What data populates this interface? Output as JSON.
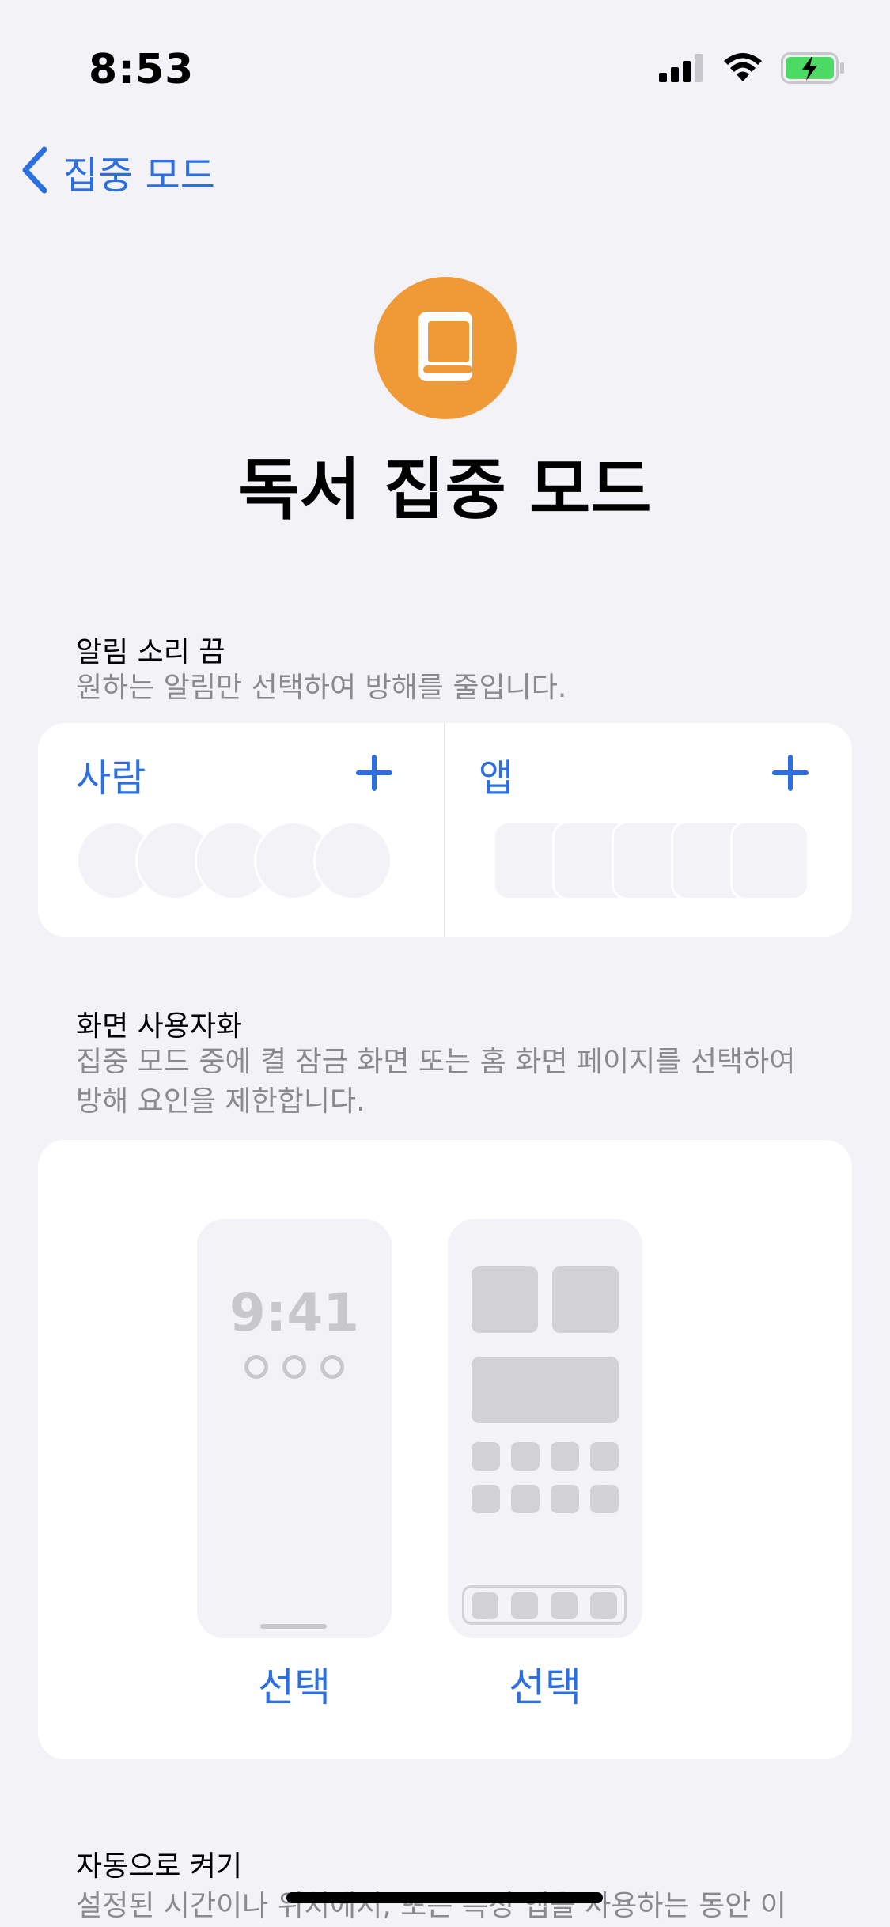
{
  "status_bar": {
    "time": "8:53",
    "signal_icon": "cellular-signal-icon",
    "wifi_icon": "wifi-icon",
    "battery_icon": "battery-charging-icon",
    "battery_color": "#4cd964"
  },
  "nav": {
    "back_label": "집중 모드",
    "back_icon": "chevron-left-icon"
  },
  "header": {
    "icon": "book-icon",
    "icon_color": "#f09a37",
    "title": "독서 집중 모드"
  },
  "notifications": {
    "title": "알림 소리 끔",
    "description": "원하는 알림만 선택하여 방해를 줄입니다.",
    "people_label": "사람",
    "apps_label": "앱",
    "add_symbol": "+"
  },
  "screens": {
    "title": "화면 사용자화",
    "description_line1": "집중 모드 중에 켤 잠금 화면 또는 홈 화면 페이지를 선택하여",
    "description_line2": "방해 요인을 제한합니다.",
    "lock_preview_time": "9:41",
    "lock_select_label": "선택",
    "home_select_label": "선택"
  },
  "auto_on": {
    "title": "자동으로 켜기",
    "description": "설정된 시간이나 위치에서, 또는 특정 앱을 사용하는 동안 이"
  },
  "accent_color": "#2c6fe0"
}
